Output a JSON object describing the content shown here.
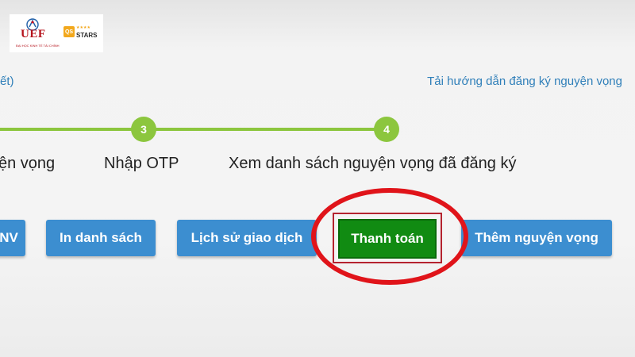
{
  "logo": {
    "name": "UEF",
    "subtitle": "ĐẠI HỌC KINH TẾ TÀI CHÍNH",
    "qs_badge": "QS",
    "qs_rating": "STARS",
    "qs_rating_top": "★★★★"
  },
  "header": {
    "left_fragment": "ết)",
    "guide_link": "Tải hướng dẫn đăng ký nguyện vọng"
  },
  "stepper": {
    "steps": [
      {
        "number": "",
        "label": "ện vọng"
      },
      {
        "number": "3",
        "label": "Nhập OTP"
      },
      {
        "number": "4",
        "label": "Xem danh sách nguyện vọng đã đăng ký"
      }
    ]
  },
  "actions": {
    "buttons": [
      {
        "label": "NV"
      },
      {
        "label": "In danh sách"
      },
      {
        "label": "Lịch sử giao dịch"
      },
      {
        "label": "Thanh toán"
      },
      {
        "label": "Thêm nguyện vọng"
      }
    ]
  },
  "colors": {
    "primary_button": "#3c8ed0",
    "pay_button": "#118b12",
    "step_green": "#8cc63e",
    "link_blue": "#2f7fb9",
    "annotation_red": "#e0141a"
  }
}
